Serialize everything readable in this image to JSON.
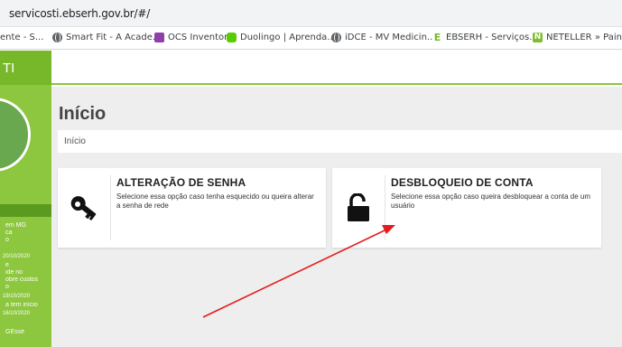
{
  "browser": {
    "url": "servicosti.ebserh.gov.br/#/",
    "bookmarks": [
      {
        "label": "ente - S...",
        "icon": "none"
      },
      {
        "label": "Smart Fit - A Acade...",
        "icon": "globe-icon"
      },
      {
        "label": "OCS Inventory",
        "icon": "ocs-icon",
        "color": "#8e3fa8"
      },
      {
        "label": "Duolingo | Aprenda...",
        "icon": "duolingo-icon",
        "color": "#58cc02"
      },
      {
        "label": "iDCE - MV Medicin...",
        "icon": "globe-icon"
      },
      {
        "label": "EBSERH - Serviços...",
        "icon": "ebserh-icon",
        "color": "#76b82a"
      },
      {
        "label": "NETELLER » Painel",
        "icon": "neteller-icon",
        "color": "#7cbf2c"
      }
    ]
  },
  "sidebar": {
    "title": "TI",
    "news": [
      {
        "lines": [
          "em MG",
          "ca",
          "o"
        ],
        "date": "20/10/2020"
      },
      {
        "lines": [
          "e",
          "ide no",
          "obre custos",
          "o"
        ],
        "date": "19/10/2020"
      },
      {
        "lines": [
          "a tem início"
        ],
        "date": "16/10/2020"
      }
    ],
    "footer_text": "GEssé"
  },
  "page": {
    "title": "Início",
    "breadcrumb": "Início"
  },
  "cards": [
    {
      "title": "ALTERAÇÃO DE SENHA",
      "description": "Selecione essa opção caso tenha esquecido ou queira alterar a senha de rede",
      "icon": "key-icon"
    },
    {
      "title": "DESBLOQUEIO DE CONTA",
      "description": "Selecione essa opção caso queira desbloquear a conta de um usuário",
      "icon": "unlock-icon"
    }
  ],
  "colors": {
    "brand_green": "#8dc63f",
    "brand_green_dark": "#76b82a",
    "annotation_arrow": "#e31b1b"
  }
}
